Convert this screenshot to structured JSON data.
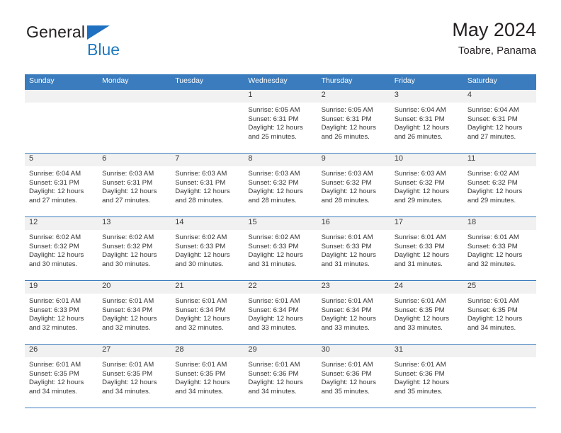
{
  "brand": {
    "word1": "General",
    "word2": "Blue",
    "triangle_color": "#1f70c1",
    "blue_text_color": "#1f7ac1"
  },
  "header": {
    "title": "May 2024",
    "subtitle": "Toabre, Panama"
  },
  "theme": {
    "header_blue": "#3a7cbe",
    "daynum_band": "#f1f1f1",
    "text": "#333333"
  },
  "weekdays": [
    "Sunday",
    "Monday",
    "Tuesday",
    "Wednesday",
    "Thursday",
    "Friday",
    "Saturday"
  ],
  "weeks": [
    [
      {
        "day": "",
        "sunrise": "",
        "sunset": "",
        "daylight1": "",
        "daylight2": "",
        "empty": true
      },
      {
        "day": "",
        "sunrise": "",
        "sunset": "",
        "daylight1": "",
        "daylight2": "",
        "empty": true
      },
      {
        "day": "",
        "sunrise": "",
        "sunset": "",
        "daylight1": "",
        "daylight2": "",
        "empty": true
      },
      {
        "day": "1",
        "sunrise": "Sunrise: 6:05 AM",
        "sunset": "Sunset: 6:31 PM",
        "daylight1": "Daylight: 12 hours",
        "daylight2": "and 25 minutes."
      },
      {
        "day": "2",
        "sunrise": "Sunrise: 6:05 AM",
        "sunset": "Sunset: 6:31 PM",
        "daylight1": "Daylight: 12 hours",
        "daylight2": "and 26 minutes."
      },
      {
        "day": "3",
        "sunrise": "Sunrise: 6:04 AM",
        "sunset": "Sunset: 6:31 PM",
        "daylight1": "Daylight: 12 hours",
        "daylight2": "and 26 minutes."
      },
      {
        "day": "4",
        "sunrise": "Sunrise: 6:04 AM",
        "sunset": "Sunset: 6:31 PM",
        "daylight1": "Daylight: 12 hours",
        "daylight2": "and 27 minutes."
      }
    ],
    [
      {
        "day": "5",
        "sunrise": "Sunrise: 6:04 AM",
        "sunset": "Sunset: 6:31 PM",
        "daylight1": "Daylight: 12 hours",
        "daylight2": "and 27 minutes."
      },
      {
        "day": "6",
        "sunrise": "Sunrise: 6:03 AM",
        "sunset": "Sunset: 6:31 PM",
        "daylight1": "Daylight: 12 hours",
        "daylight2": "and 27 minutes."
      },
      {
        "day": "7",
        "sunrise": "Sunrise: 6:03 AM",
        "sunset": "Sunset: 6:31 PM",
        "daylight1": "Daylight: 12 hours",
        "daylight2": "and 28 minutes."
      },
      {
        "day": "8",
        "sunrise": "Sunrise: 6:03 AM",
        "sunset": "Sunset: 6:32 PM",
        "daylight1": "Daylight: 12 hours",
        "daylight2": "and 28 minutes."
      },
      {
        "day": "9",
        "sunrise": "Sunrise: 6:03 AM",
        "sunset": "Sunset: 6:32 PM",
        "daylight1": "Daylight: 12 hours",
        "daylight2": "and 28 minutes."
      },
      {
        "day": "10",
        "sunrise": "Sunrise: 6:03 AM",
        "sunset": "Sunset: 6:32 PM",
        "daylight1": "Daylight: 12 hours",
        "daylight2": "and 29 minutes."
      },
      {
        "day": "11",
        "sunrise": "Sunrise: 6:02 AM",
        "sunset": "Sunset: 6:32 PM",
        "daylight1": "Daylight: 12 hours",
        "daylight2": "and 29 minutes."
      }
    ],
    [
      {
        "day": "12",
        "sunrise": "Sunrise: 6:02 AM",
        "sunset": "Sunset: 6:32 PM",
        "daylight1": "Daylight: 12 hours",
        "daylight2": "and 30 minutes."
      },
      {
        "day": "13",
        "sunrise": "Sunrise: 6:02 AM",
        "sunset": "Sunset: 6:32 PM",
        "daylight1": "Daylight: 12 hours",
        "daylight2": "and 30 minutes."
      },
      {
        "day": "14",
        "sunrise": "Sunrise: 6:02 AM",
        "sunset": "Sunset: 6:33 PM",
        "daylight1": "Daylight: 12 hours",
        "daylight2": "and 30 minutes."
      },
      {
        "day": "15",
        "sunrise": "Sunrise: 6:02 AM",
        "sunset": "Sunset: 6:33 PM",
        "daylight1": "Daylight: 12 hours",
        "daylight2": "and 31 minutes."
      },
      {
        "day": "16",
        "sunrise": "Sunrise: 6:01 AM",
        "sunset": "Sunset: 6:33 PM",
        "daylight1": "Daylight: 12 hours",
        "daylight2": "and 31 minutes."
      },
      {
        "day": "17",
        "sunrise": "Sunrise: 6:01 AM",
        "sunset": "Sunset: 6:33 PM",
        "daylight1": "Daylight: 12 hours",
        "daylight2": "and 31 minutes."
      },
      {
        "day": "18",
        "sunrise": "Sunrise: 6:01 AM",
        "sunset": "Sunset: 6:33 PM",
        "daylight1": "Daylight: 12 hours",
        "daylight2": "and 32 minutes."
      }
    ],
    [
      {
        "day": "19",
        "sunrise": "Sunrise: 6:01 AM",
        "sunset": "Sunset: 6:33 PM",
        "daylight1": "Daylight: 12 hours",
        "daylight2": "and 32 minutes."
      },
      {
        "day": "20",
        "sunrise": "Sunrise: 6:01 AM",
        "sunset": "Sunset: 6:34 PM",
        "daylight1": "Daylight: 12 hours",
        "daylight2": "and 32 minutes."
      },
      {
        "day": "21",
        "sunrise": "Sunrise: 6:01 AM",
        "sunset": "Sunset: 6:34 PM",
        "daylight1": "Daylight: 12 hours",
        "daylight2": "and 32 minutes."
      },
      {
        "day": "22",
        "sunrise": "Sunrise: 6:01 AM",
        "sunset": "Sunset: 6:34 PM",
        "daylight1": "Daylight: 12 hours",
        "daylight2": "and 33 minutes."
      },
      {
        "day": "23",
        "sunrise": "Sunrise: 6:01 AM",
        "sunset": "Sunset: 6:34 PM",
        "daylight1": "Daylight: 12 hours",
        "daylight2": "and 33 minutes."
      },
      {
        "day": "24",
        "sunrise": "Sunrise: 6:01 AM",
        "sunset": "Sunset: 6:35 PM",
        "daylight1": "Daylight: 12 hours",
        "daylight2": "and 33 minutes."
      },
      {
        "day": "25",
        "sunrise": "Sunrise: 6:01 AM",
        "sunset": "Sunset: 6:35 PM",
        "daylight1": "Daylight: 12 hours",
        "daylight2": "and 34 minutes."
      }
    ],
    [
      {
        "day": "26",
        "sunrise": "Sunrise: 6:01 AM",
        "sunset": "Sunset: 6:35 PM",
        "daylight1": "Daylight: 12 hours",
        "daylight2": "and 34 minutes."
      },
      {
        "day": "27",
        "sunrise": "Sunrise: 6:01 AM",
        "sunset": "Sunset: 6:35 PM",
        "daylight1": "Daylight: 12 hours",
        "daylight2": "and 34 minutes."
      },
      {
        "day": "28",
        "sunrise": "Sunrise: 6:01 AM",
        "sunset": "Sunset: 6:35 PM",
        "daylight1": "Daylight: 12 hours",
        "daylight2": "and 34 minutes."
      },
      {
        "day": "29",
        "sunrise": "Sunrise: 6:01 AM",
        "sunset": "Sunset: 6:36 PM",
        "daylight1": "Daylight: 12 hours",
        "daylight2": "and 34 minutes."
      },
      {
        "day": "30",
        "sunrise": "Sunrise: 6:01 AM",
        "sunset": "Sunset: 6:36 PM",
        "daylight1": "Daylight: 12 hours",
        "daylight2": "and 35 minutes."
      },
      {
        "day": "31",
        "sunrise": "Sunrise: 6:01 AM",
        "sunset": "Sunset: 6:36 PM",
        "daylight1": "Daylight: 12 hours",
        "daylight2": "and 35 minutes."
      },
      {
        "day": "",
        "sunrise": "",
        "sunset": "",
        "daylight1": "",
        "daylight2": "",
        "empty": true
      }
    ]
  ]
}
